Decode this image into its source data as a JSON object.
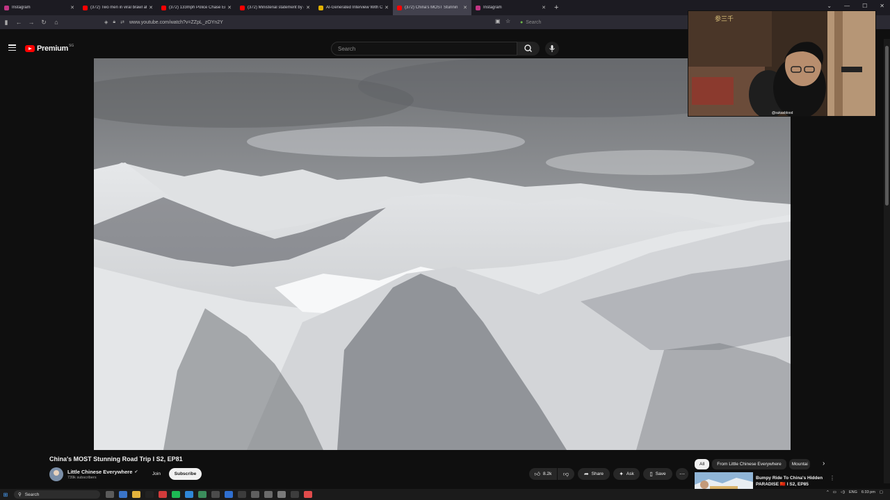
{
  "browser": {
    "tabs": [
      {
        "label": "Instagram",
        "color": "#c13584"
      },
      {
        "label": "(372) Two men in viral brawl at",
        "color": "#ff0000"
      },
      {
        "label": "(372) 133mph Police Chase End",
        "color": "#ff0000"
      },
      {
        "label": "(372) Ministerial statement by (",
        "color": "#ff0000"
      },
      {
        "label": "AI-Generated Interview With C",
        "color": "#e0b000"
      },
      {
        "label": "(372) China's MOST Stunnin",
        "color": "#ff0000"
      },
      {
        "label": "Instagram",
        "color": "#c13584"
      }
    ],
    "active_tab": 5,
    "url": "www.youtube.com/watch?v=ZZpL_zOYn2Y",
    "search_placeholder": "Search"
  },
  "youtube": {
    "logo_text": "Premium",
    "logo_country": "SG",
    "search_placeholder": "Search"
  },
  "webcam": {
    "handle": "@sukasblood",
    "sign_text": "参三千"
  },
  "video": {
    "title": "China's MOST Stunning Road Trip I S2, EP81",
    "channel_name": "Little Chinese Everywhere",
    "subscribers": "739k subscribers",
    "join_label": "Join",
    "subscribe_label": "Subscribe",
    "likes": "8.2k",
    "share_label": "Share",
    "ask_label": "Ask",
    "save_label": "Save"
  },
  "sidebar": {
    "chips": [
      "All",
      "From Little Chinese Everywhere",
      "Mountai"
    ],
    "selected_chip": "All",
    "recommendation_title": "Bumpy Ride To China's Hidden PARADISE 🇨🇳 I S2, EP85"
  },
  "taskbar": {
    "search_label": "Search",
    "language": "ENG",
    "time": "6:33 pm"
  },
  "colors": {
    "yt_red": "#ff0000",
    "bg": "#0f0f0f"
  }
}
